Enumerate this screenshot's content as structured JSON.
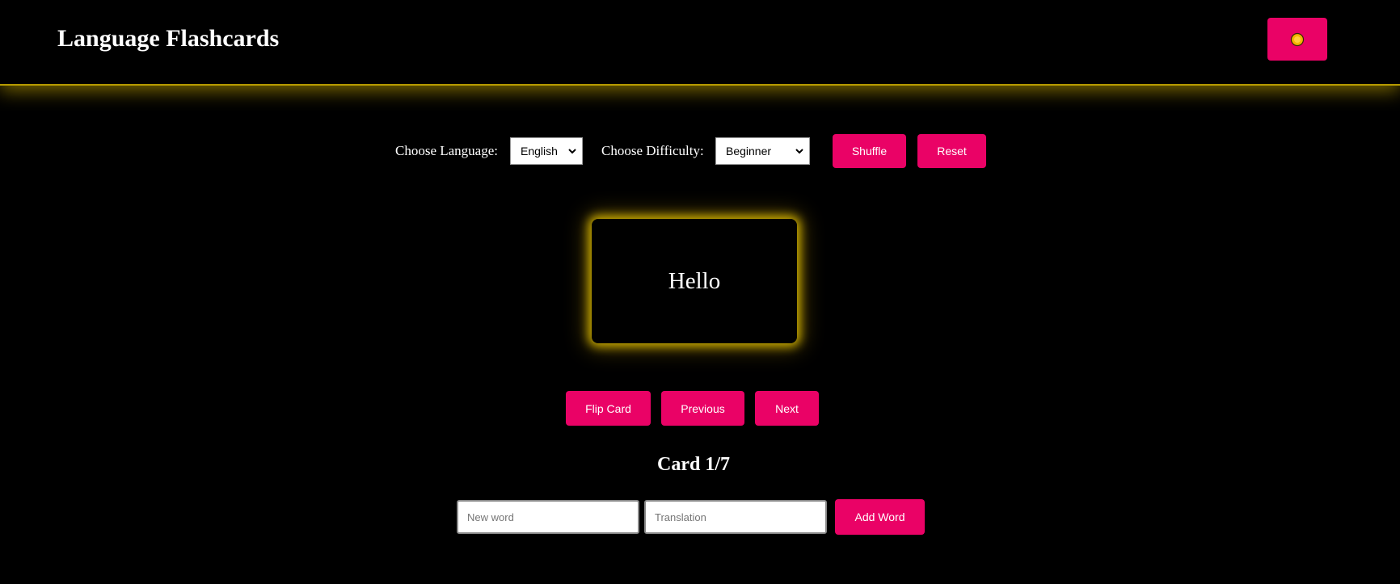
{
  "header": {
    "title": "Language Flashcards",
    "theme_toggle_icon": "sun-icon"
  },
  "controls": {
    "language_label": "Choose Language:",
    "language_selected": "English",
    "difficulty_label": "Choose Difficulty:",
    "difficulty_selected": "Beginner",
    "shuffle_label": "Shuffle",
    "reset_label": "Reset"
  },
  "card": {
    "word": "Hello"
  },
  "navigation": {
    "flip_label": "Flip Card",
    "previous_label": "Previous",
    "next_label": "Next"
  },
  "counter": {
    "text": "Card 1/7"
  },
  "add_word": {
    "word_placeholder": "New word",
    "translation_placeholder": "Translation",
    "button_label": "Add Word"
  },
  "colors": {
    "background": "#000000",
    "accent": "#ea0266",
    "glow": "#e8c400",
    "text": "#ffffff"
  }
}
